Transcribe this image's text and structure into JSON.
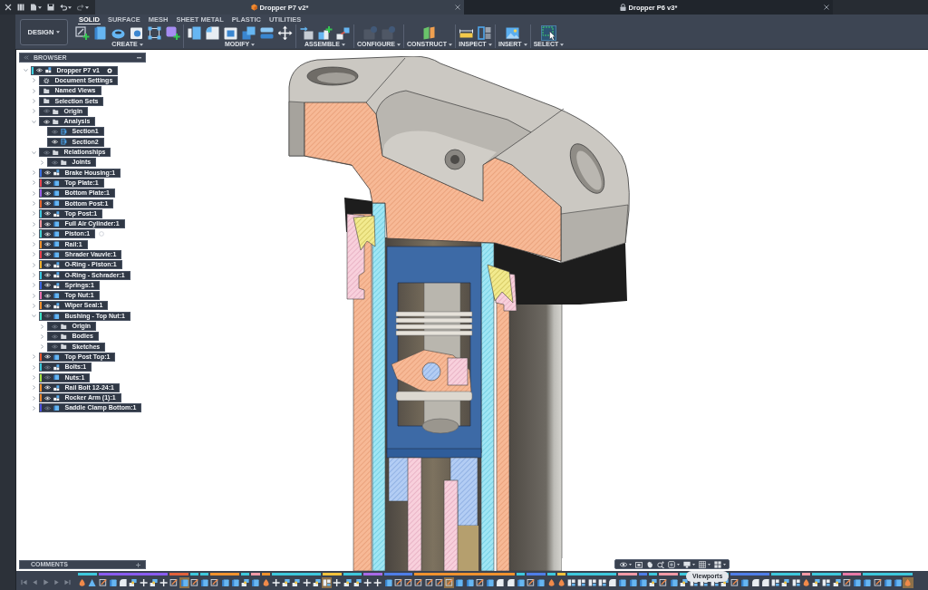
{
  "quick_access": [
    {
      "kind": "close",
      "disabled": false,
      "dropdown": false
    },
    {
      "kind": "apps",
      "disabled": false,
      "dropdown": false
    },
    {
      "kind": "file",
      "disabled": false,
      "dropdown": true
    },
    {
      "kind": "save",
      "disabled": false,
      "dropdown": false
    },
    {
      "kind": "undo",
      "disabled": false,
      "dropdown": true
    },
    {
      "kind": "redo",
      "disabled": true,
      "dropdown": true
    }
  ],
  "title_bar": {
    "tabs": [
      {
        "title": "Dropper P7 v2*",
        "selected": true,
        "locked": false
      },
      {
        "title": "Dropper P6 v3*",
        "selected": false,
        "locked": true
      }
    ]
  },
  "workspace": {
    "label": "DESIGN"
  },
  "toolbar_tabs": [
    {
      "label": "SOLID",
      "selected": true
    },
    {
      "label": "SURFACE",
      "selected": false
    },
    {
      "label": "MESH",
      "selected": false
    },
    {
      "label": "SHEET METAL",
      "selected": false
    },
    {
      "label": "PLASTIC",
      "selected": false
    },
    {
      "label": "UTILITIES",
      "selected": false
    }
  ],
  "tool_groups": [
    {
      "label": "CREATE",
      "tools": [
        {
          "kind": "sketch",
          "disabled": false,
          "selected": false
        },
        {
          "kind": "extrude",
          "disabled": false,
          "selected": false
        },
        {
          "kind": "revolve",
          "disabled": false,
          "selected": false
        },
        {
          "kind": "hole",
          "disabled": false,
          "selected": false
        },
        {
          "kind": "pattern",
          "disabled": false,
          "selected": false
        },
        {
          "kind": "form",
          "disabled": false,
          "selected": false
        }
      ]
    },
    {
      "label": "MODIFY",
      "tools": [
        {
          "kind": "presspull",
          "disabled": false,
          "selected": false
        },
        {
          "kind": "fillet",
          "disabled": false,
          "selected": false
        },
        {
          "kind": "shell",
          "disabled": false,
          "selected": false
        },
        {
          "kind": "combine",
          "disabled": false,
          "selected": false
        },
        {
          "kind": "split",
          "disabled": false,
          "selected": false
        },
        {
          "kind": "move",
          "disabled": false,
          "selected": false
        }
      ]
    },
    {
      "label": "ASSEMBLE",
      "tools": [
        {
          "kind": "component",
          "disabled": false,
          "selected": false
        },
        {
          "kind": "joint",
          "disabled": false,
          "selected": false
        },
        {
          "kind": "asbuilt",
          "disabled": false,
          "selected": false
        }
      ]
    },
    {
      "label": "CONFIGURE",
      "tools": [
        {
          "kind": "configure",
          "disabled": true,
          "selected": false
        },
        {
          "kind": "configure",
          "disabled": true,
          "selected": false
        }
      ]
    },
    {
      "label": "CONSTRUCT",
      "tools": [
        {
          "kind": "plane",
          "disabled": false,
          "selected": false
        }
      ]
    },
    {
      "label": "INSPECT",
      "tools": [
        {
          "kind": "measure",
          "disabled": false,
          "selected": false
        },
        {
          "kind": "section",
          "disabled": false,
          "selected": false
        }
      ]
    },
    {
      "label": "INSERT",
      "tools": [
        {
          "kind": "image",
          "disabled": false,
          "selected": false
        }
      ]
    },
    {
      "label": "SELECT",
      "tools": [
        {
          "kind": "select",
          "disabled": false,
          "selected": true
        }
      ]
    }
  ],
  "browser": {
    "title": "BROWSER",
    "items": [
      {
        "label": "Dropper P7 v1",
        "kind": "assembly",
        "color": "#3ed0e0",
        "visible": true,
        "expanded": true,
        "active": true,
        "children": [
          {
            "label": "Document Settings",
            "kind": "settings",
            "expanded": false
          },
          {
            "label": "Named Views",
            "kind": "folder",
            "expanded": false
          },
          {
            "label": "Selection Sets",
            "kind": "folder",
            "expanded": false
          },
          {
            "label": "Origin",
            "kind": "folder",
            "visible": false,
            "expanded": false
          },
          {
            "label": "Analysis",
            "kind": "folder",
            "visible": true,
            "expanded": true,
            "children": [
              {
                "label": "Section1",
                "kind": "section",
                "visible": false
              },
              {
                "label": "Section2",
                "kind": "section",
                "visible": true
              }
            ]
          },
          {
            "label": "Relationships",
            "kind": "folder",
            "visible": false,
            "expanded": true,
            "children": [
              {
                "label": "Joints",
                "kind": "folder",
                "visible": false,
                "expanded": false
              }
            ]
          },
          {
            "label": "Brake Housing:1",
            "kind": "assembly",
            "color": "#3a6fe0",
            "visible": true,
            "expanded": false
          },
          {
            "label": "Top Plate:1",
            "kind": "part",
            "color": "#e8454f",
            "visible": true,
            "expanded": false
          },
          {
            "label": "Bottom Plate:1",
            "kind": "part",
            "color": "#9b5de8",
            "visible": true,
            "expanded": false
          },
          {
            "label": "Bottom Post:1",
            "kind": "part",
            "color": "#e8672e",
            "visible": true,
            "expanded": false
          },
          {
            "label": "Top Post:1",
            "kind": "assembly",
            "color": "#3ec8e0",
            "visible": true,
            "expanded": false
          },
          {
            "label": "Full Air Cylinder:1",
            "kind": "part",
            "color": "#f2949c",
            "visible": true,
            "expanded": false
          },
          {
            "label": "Piston:1",
            "kind": "part",
            "color": "#42d2d6",
            "visible": true,
            "expanded": false,
            "active": false
          },
          {
            "label": "Rail:1",
            "kind": "part",
            "color": "#f0902e",
            "visible": true,
            "expanded": false
          },
          {
            "label": "Shrader Vauvle:1",
            "kind": "part",
            "color": "#e8404a",
            "visible": true,
            "expanded": false
          },
          {
            "label": "O-Ring - Piston:1",
            "kind": "assembly",
            "color": "#f2b02e",
            "visible": true,
            "expanded": false
          },
          {
            "label": "O-Ring - Schrader:1",
            "kind": "assembly",
            "color": "#38c6e0",
            "visible": true,
            "expanded": false
          },
          {
            "label": "Springs:1",
            "kind": "assembly",
            "color": "#3a66e0",
            "visible": true,
            "expanded": false
          },
          {
            "label": "Top Nut:1",
            "kind": "part",
            "color": "#e66fae",
            "visible": true,
            "expanded": false
          },
          {
            "label": "Wiper Seal:1",
            "kind": "assembly",
            "color": "#f0902e",
            "visible": true,
            "expanded": false
          },
          {
            "label": "Bushing - Top Nut:1",
            "kind": "part",
            "color": "#3fe0c4",
            "visible": false,
            "expanded": true,
            "children": [
              {
                "label": "Origin",
                "kind": "folder",
                "visible": false,
                "expanded": false
              },
              {
                "label": "Bodies",
                "kind": "folder",
                "visible": false,
                "expanded": false
              },
              {
                "label": "Sketches",
                "kind": "folder",
                "visible": false,
                "expanded": false
              }
            ]
          },
          {
            "label": "Top Post Top:1",
            "kind": "part",
            "color": "#e8582e",
            "visible": true,
            "expanded": false
          },
          {
            "label": "Bolts:1",
            "kind": "assembly",
            "color": "#38c6d8",
            "visible": false,
            "expanded": false
          },
          {
            "label": "Nuts:1",
            "kind": "part",
            "color": "#a6e03e",
            "visible": false,
            "expanded": false
          },
          {
            "label": "Rail Bolt 12-24:1",
            "kind": "assembly",
            "color": "#f0902e",
            "visible": true,
            "expanded": false
          },
          {
            "label": "Rocker Arm (1):1",
            "kind": "assembly",
            "color": "#e8862e",
            "visible": true,
            "expanded": false
          },
          {
            "label": "Saddle Clamp Bottom:1",
            "kind": "part",
            "color": "#4a4ee0",
            "visible": false,
            "expanded": false
          }
        ]
      }
    ]
  },
  "comments": {
    "title": "COMMENTS"
  },
  "navigation_bar": {
    "tools": [
      {
        "kind": "orbit",
        "dropdown": true
      },
      {
        "kind": "look",
        "dropdown": false
      },
      {
        "kind": "pan",
        "dropdown": false
      },
      {
        "kind": "zoom",
        "dropdown": false
      },
      {
        "kind": "fit",
        "dropdown": true
      },
      {
        "kind": "display",
        "dropdown": true
      },
      {
        "kind": "grid",
        "dropdown": true
      },
      {
        "kind": "viewports",
        "dropdown": true
      }
    ]
  },
  "tooltip": {
    "text": "Viewports"
  },
  "timeline": {
    "groups": [
      {
        "color": "#3ec8dc",
        "features": [
          {
            "kind": "appearance",
            "selected": false
          },
          {
            "kind": "plane",
            "selected": false
          }
        ]
      },
      {
        "color": "#8a5cf0",
        "features": [
          {
            "kind": "sketch",
            "selected": false
          },
          {
            "kind": "body",
            "selected": false
          },
          {
            "kind": "fillet",
            "selected": false
          },
          {
            "kind": "joint",
            "selected": false
          },
          {
            "kind": "move",
            "selected": false
          },
          {
            "kind": "joint",
            "selected": false
          },
          {
            "kind": "move",
            "selected": false
          }
        ]
      },
      {
        "color": "#e0603a",
        "features": [
          {
            "kind": "sketch",
            "selected": false
          },
          {
            "kind": "body",
            "selected": true
          }
        ]
      },
      {
        "color": "#3ec8dc",
        "features": [
          {
            "kind": "sketch",
            "selected": false
          }
        ]
      },
      {
        "color": "#3ec8dc",
        "features": [
          {
            "kind": "body",
            "selected": false
          }
        ]
      },
      {
        "color": "#f0922e",
        "features": [
          {
            "kind": "sketch",
            "selected": false
          },
          {
            "kind": "body",
            "selected": false
          },
          {
            "kind": "body",
            "selected": false
          }
        ]
      },
      {
        "color": "#3ec8dc",
        "features": [
          {
            "kind": "joint",
            "selected": false
          }
        ]
      },
      {
        "color": "#f29aa6",
        "features": [
          {
            "kind": "body",
            "selected": false
          }
        ]
      },
      {
        "color": "#f0922e",
        "features": [
          {
            "kind": "appearance",
            "selected": false
          }
        ]
      },
      {
        "color": "#3ec8dc",
        "features": [
          {
            "kind": "move",
            "selected": false
          },
          {
            "kind": "joint",
            "selected": false
          },
          {
            "kind": "joint",
            "selected": false
          },
          {
            "kind": "move",
            "selected": false
          },
          {
            "kind": "joint",
            "selected": false
          }
        ]
      },
      {
        "color": "#f3c23c",
        "features": [
          {
            "kind": "rigid",
            "selected": true
          },
          {
            "kind": "move",
            "selected": false
          }
        ]
      },
      {
        "color": "#3ec8dc",
        "features": [
          {
            "kind": "joint",
            "selected": false
          },
          {
            "kind": "joint",
            "selected": false
          }
        ]
      },
      {
        "color": "#a86ae8",
        "features": [
          {
            "kind": "move",
            "selected": false
          },
          {
            "kind": "move",
            "selected": false
          }
        ]
      },
      {
        "color": "#4f7ee8",
        "features": [
          {
            "kind": "body",
            "selected": false
          },
          {
            "kind": "sketch",
            "selected": false
          },
          {
            "kind": "sketch",
            "selected": false
          }
        ]
      },
      {
        "color": "#f0922e",
        "features": [
          {
            "kind": "sketch",
            "selected": false
          },
          {
            "kind": "sketch",
            "selected": false
          },
          {
            "kind": "sketch",
            "selected": false
          },
          {
            "kind": "sketch",
            "selected": true
          },
          {
            "kind": "body",
            "selected": false
          },
          {
            "kind": "body",
            "selected": false
          },
          {
            "kind": "sketch",
            "selected": false
          },
          {
            "kind": "body",
            "selected": false
          },
          {
            "kind": "fillet",
            "selected": false
          },
          {
            "kind": "fillet",
            "selected": false
          }
        ]
      },
      {
        "color": "#3ec8dc",
        "features": [
          {
            "kind": "body",
            "selected": false
          }
        ]
      },
      {
        "color": "#4f7ee8",
        "features": [
          {
            "kind": "sketch",
            "selected": false
          },
          {
            "kind": "body",
            "selected": false
          }
        ]
      },
      {
        "color": "#3ec8dc",
        "features": [
          {
            "kind": "appearance",
            "selected": false
          }
        ]
      },
      {
        "color": "#f3c23c",
        "features": [
          {
            "kind": "appearance",
            "selected": false
          }
        ]
      },
      {
        "color": "#3ec8dc",
        "features": [
          {
            "kind": "rigid",
            "selected": false
          },
          {
            "kind": "rigid",
            "selected": false
          },
          {
            "kind": "rigid",
            "selected": false
          },
          {
            "kind": "rigid",
            "selected": false
          },
          {
            "kind": "fillet",
            "selected": false
          }
        ]
      },
      {
        "color": "#f29aa6",
        "features": [
          {
            "kind": "body",
            "selected": false
          },
          {
            "kind": "body",
            "selected": false
          }
        ]
      },
      {
        "color": "#4f7ee8",
        "features": [
          {
            "kind": "body",
            "selected": false
          }
        ]
      },
      {
        "color": "#3ec8dc",
        "features": [
          {
            "kind": "joint",
            "selected": false
          }
        ]
      },
      {
        "color": "#f29aa6",
        "features": [
          {
            "kind": "sketch",
            "selected": false
          },
          {
            "kind": "body",
            "selected": false
          }
        ]
      },
      {
        "color": "#3ec8dc",
        "features": [
          {
            "kind": "joint",
            "selected": false
          },
          {
            "kind": "rigid",
            "selected": false
          },
          {
            "kind": "rigid",
            "selected": false
          },
          {
            "kind": "rigid",
            "selected": false
          },
          {
            "kind": "joint",
            "selected": false
          }
        ]
      },
      {
        "color": "#4f7ee8",
        "features": [
          {
            "kind": "sketch",
            "selected": false
          },
          {
            "kind": "body",
            "selected": false
          },
          {
            "kind": "fillet",
            "selected": false
          },
          {
            "kind": "fillet",
            "selected": false
          }
        ]
      },
      {
        "color": "#3ec8dc",
        "features": [
          {
            "kind": "rigid",
            "selected": false
          },
          {
            "kind": "joint",
            "selected": false
          },
          {
            "kind": "rigid",
            "selected": false
          }
        ]
      },
      {
        "color": "#f29aa6",
        "features": [
          {
            "kind": "appearance",
            "selected": false
          }
        ]
      },
      {
        "color": "#3ec8dc",
        "features": [
          {
            "kind": "joint",
            "selected": false
          },
          {
            "kind": "rigid",
            "selected": false
          },
          {
            "kind": "joint",
            "selected": false
          }
        ]
      },
      {
        "color": "#e87aa8",
        "features": [
          {
            "kind": "sketch",
            "selected": false
          },
          {
            "kind": "body",
            "selected": false
          }
        ]
      },
      {
        "color": "#3ec8dc",
        "features": [
          {
            "kind": "body",
            "selected": false
          },
          {
            "kind": "sketch",
            "selected": false
          },
          {
            "kind": "body",
            "selected": false
          },
          {
            "kind": "body",
            "selected": false
          },
          {
            "kind": "appearance",
            "selected": true
          }
        ]
      }
    ]
  }
}
